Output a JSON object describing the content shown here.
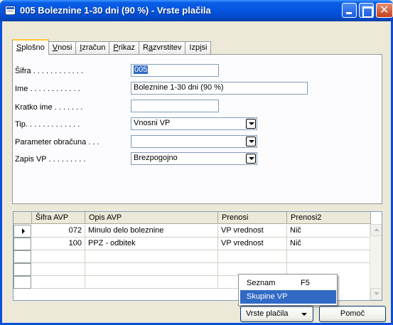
{
  "window": {
    "title": "005 Boleznine 1-30 dni (90 %) - Vrste plačila"
  },
  "tabs": [
    {
      "label": "Splošno",
      "ul": "S",
      "rest": "plošno"
    },
    {
      "label": "Vnosi",
      "ul": "V",
      "rest": "nosi"
    },
    {
      "label": "Izračun",
      "ul": "I",
      "rest": "zračun"
    },
    {
      "label": "Prikaz",
      "ul": "P",
      "rest": "rikaz"
    },
    {
      "label": "Razvrstitev",
      "pre": "R",
      "ul": "a",
      "rest": "zvrstitev"
    },
    {
      "label": "Izpisi",
      "pre": "Izp",
      "ul": "i",
      "rest": "si"
    }
  ],
  "form": {
    "sifra_label": "Šifra . . . . . . . . . . . .",
    "sifra_value": "005",
    "ime_label": "Ime . . . . . . . . . . . .",
    "ime_value": "Boleznine 1-30 dni (90 %)",
    "kratko_label": "Kratko ime . . . . . . .",
    "kratko_value": "",
    "tip_label": "Tip. . . . . . . . . . . . .",
    "tip_value": "Vnosni VP",
    "param_label": "Parameter obračuna . . .",
    "param_value": "",
    "zapis_label": "Zapis VP . . . . . . . . .",
    "zapis_value": "Brezpogojno"
  },
  "grid": {
    "headers": [
      "Šifra AVP",
      "Opis AVP",
      "Prenosi",
      "Prenosi2"
    ],
    "rows": [
      {
        "sifra": "072",
        "opis": "Minulo delo boleznine",
        "prenosi": "VP vrednost",
        "prenosi2": "Nič"
      },
      {
        "sifra": "100",
        "opis": "PPZ - odbitek",
        "prenosi": "VP vrednost",
        "prenosi2": "Nič"
      }
    ]
  },
  "menu": {
    "items": [
      {
        "label": "Seznam",
        "shortcut": "F5"
      },
      {
        "label": "Skupine VP",
        "shortcut": ""
      }
    ]
  },
  "buttons": {
    "vrste_placila": "Vrste plačila",
    "pomoc": "Pomoč"
  },
  "colors": {
    "title_bar": "#0454e0",
    "selection": "#316ac5",
    "tab_highlight": "#ffc83c"
  }
}
